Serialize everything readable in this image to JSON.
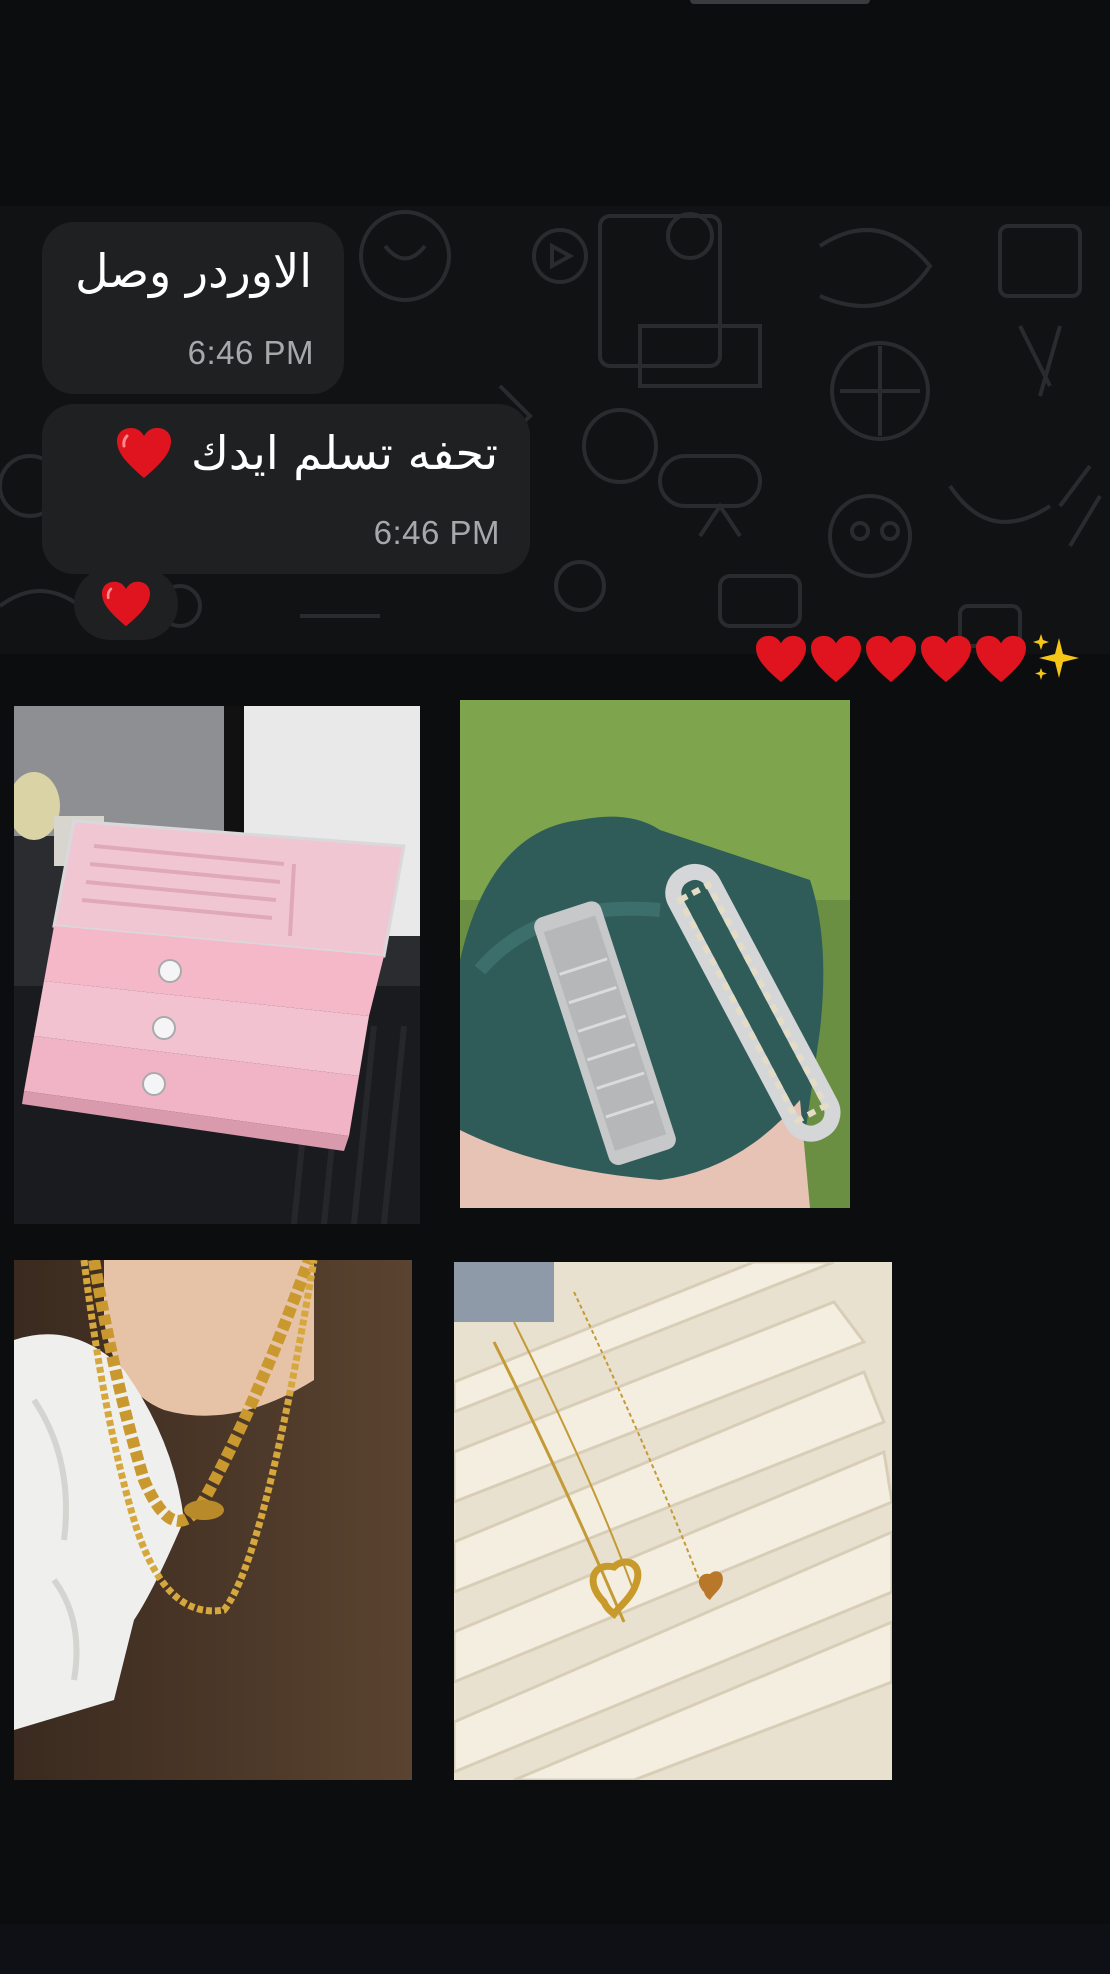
{
  "messages": [
    {
      "text": "الاوردر وصل",
      "time": "6:46 PM"
    },
    {
      "text": "تحفه تسلم ايدك",
      "emoji": "red-heart",
      "time": "6:46 PM"
    }
  ],
  "reaction": {
    "emoji": "red-heart"
  },
  "caption": {
    "emojis": [
      "red-heart",
      "red-heart",
      "red-heart",
      "red-heart",
      "red-heart",
      "sparkles"
    ]
  },
  "photos": [
    {
      "subject": "pink-jewelry-organizer-drawers"
    },
    {
      "subject": "silver-bracelets-on-teal-cushion"
    },
    {
      "subject": "gold-chain-necklaces"
    },
    {
      "subject": "gold-heart-pendant-necklaces"
    }
  ],
  "colors": {
    "background": "#0c0d0f",
    "bubble": "#1f2022",
    "timestamp": "#a7a8ab",
    "heart": "#e0141f",
    "sparkle": "#f5c518"
  }
}
